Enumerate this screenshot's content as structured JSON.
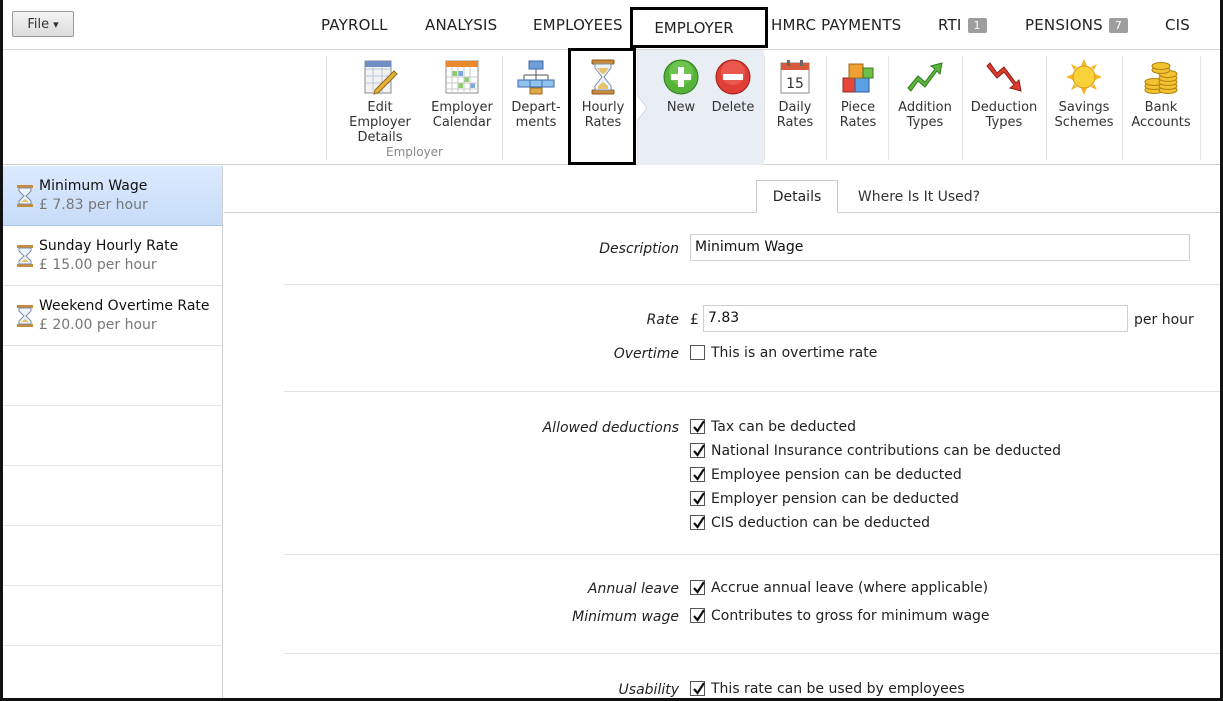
{
  "file_menu": {
    "label": "File",
    "arrow": "▾"
  },
  "nav": {
    "items": [
      {
        "label": "PAYROLL"
      },
      {
        "label": "ANALYSIS"
      },
      {
        "label": "EMPLOYEES"
      },
      {
        "label": "EMPLOYER"
      },
      {
        "label": "HMRC PAYMENTS"
      },
      {
        "label": "RTI",
        "badge": "1"
      },
      {
        "label": "PENSIONS",
        "badge": "7"
      },
      {
        "label": "CIS"
      }
    ],
    "active": "EMPLOYER"
  },
  "ribbon": {
    "edit_employer": [
      "Edit Employer",
      "Details"
    ],
    "employer_calendar": [
      "Employer",
      "Calendar"
    ],
    "departments": [
      "Depart-",
      "ments"
    ],
    "hourly_rates": [
      "Hourly",
      "Rates"
    ],
    "new": "New",
    "delete": "Delete",
    "daily_rates": [
      "Daily",
      "Rates"
    ],
    "piece_rates": [
      "Piece",
      "Rates"
    ],
    "addition_types": [
      "Addition",
      "Types"
    ],
    "deduction_types": [
      "Deduction",
      "Types"
    ],
    "savings_schemes": [
      "Savings",
      "Schemes"
    ],
    "bank_accounts": [
      "Bank",
      "Accounts"
    ],
    "group_label": "Employer",
    "calendar_day": "15"
  },
  "rates_list": [
    {
      "name": "Minimum Wage",
      "rate": "£ 7.83 per hour",
      "selected": true
    },
    {
      "name": "Sunday Hourly Rate",
      "rate": "£ 15.00 per hour",
      "selected": false
    },
    {
      "name": "Weekend Overtime Rate",
      "rate": "£ 20.00 per hour",
      "selected": false
    }
  ],
  "tabs": {
    "details": "Details",
    "where_used": "Where Is It Used?"
  },
  "form": {
    "description_label": "Description",
    "description_value": "Minimum Wage",
    "rate_label": "Rate",
    "currency": "£",
    "rate_value": "7.83",
    "per_hour": "per hour",
    "overtime_label": "Overtime",
    "overtime_text": "This is an overtime rate",
    "overtime_checked": false,
    "allowed_label": "Allowed deductions",
    "deductions": [
      {
        "text": "Tax can be deducted",
        "checked": true
      },
      {
        "text": "National Insurance contributions can be deducted",
        "checked": true
      },
      {
        "text": "Employee pension can be deducted",
        "checked": true
      },
      {
        "text": "Employer pension can be deducted",
        "checked": true
      },
      {
        "text": "CIS deduction can be deducted",
        "checked": true
      }
    ],
    "annual_leave_label": "Annual leave",
    "annual_leave_text": "Accrue annual leave (where applicable)",
    "min_wage_label": "Minimum wage",
    "min_wage_text": "Contributes to gross for minimum wage",
    "usability_label": "Usability",
    "usability_text": "This rate can be used by employees"
  }
}
